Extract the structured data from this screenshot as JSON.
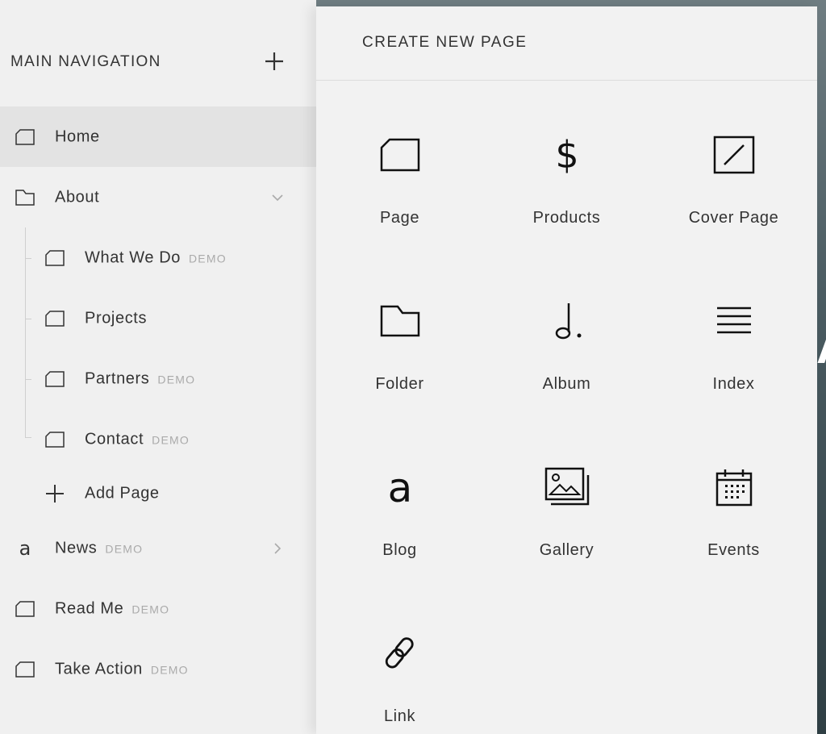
{
  "sidebar": {
    "title": "MAIN NAVIGATION",
    "items": [
      {
        "label": "Home",
        "icon": "page-icon",
        "active": true
      },
      {
        "label": "About",
        "icon": "folder-icon",
        "expanded": true
      },
      {
        "label": "What We Do",
        "icon": "page-icon",
        "badge": "DEMO"
      },
      {
        "label": "Projects",
        "icon": "page-icon"
      },
      {
        "label": "Partners",
        "icon": "page-icon",
        "badge": "DEMO"
      },
      {
        "label": "Contact",
        "icon": "page-icon",
        "badge": "DEMO"
      },
      {
        "label": "Add Page",
        "icon": "plus-icon"
      },
      {
        "label": "News",
        "icon": "blog-icon",
        "badge": "DEMO"
      },
      {
        "label": "Read Me",
        "icon": "page-icon",
        "badge": "DEMO"
      },
      {
        "label": "Take Action",
        "icon": "page-icon",
        "badge": "DEMO"
      }
    ]
  },
  "panel": {
    "title": "CREATE NEW PAGE",
    "types": [
      {
        "label": "Page",
        "icon": "page-icon"
      },
      {
        "label": "Products",
        "icon": "dollar-icon"
      },
      {
        "label": "Cover Page",
        "icon": "cover-page-icon"
      },
      {
        "label": "Folder",
        "icon": "folder-icon"
      },
      {
        "label": "Album",
        "icon": "music-note-icon"
      },
      {
        "label": "Index",
        "icon": "index-lines-icon"
      },
      {
        "label": "Blog",
        "icon": "blog-icon"
      },
      {
        "label": "Gallery",
        "icon": "gallery-icon"
      },
      {
        "label": "Events",
        "icon": "calendar-icon"
      },
      {
        "label": "Link",
        "icon": "link-icon"
      }
    ]
  },
  "colors": {
    "sidebar_bg": "#f0f0f0",
    "active_row_bg": "#e3e3e3",
    "panel_bg": "#f2f2f2",
    "text": "#333333",
    "badge_text": "#aaaaaa"
  }
}
